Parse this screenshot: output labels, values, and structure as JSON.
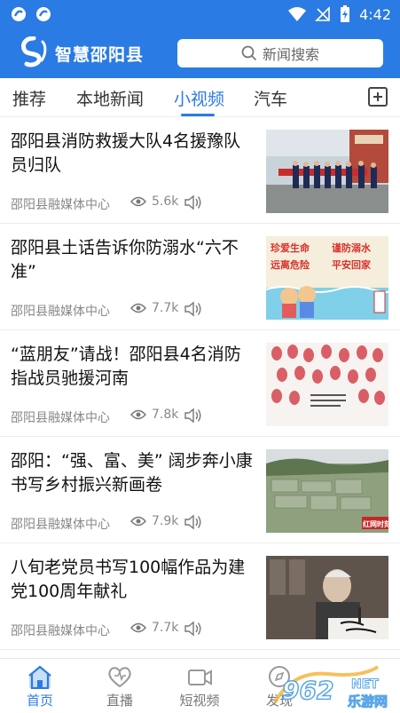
{
  "status_bar": {
    "time": "4:42"
  },
  "header": {
    "app_name": "智慧邵阳县",
    "search_placeholder": "新闻搜索"
  },
  "tabs": [
    {
      "label": "推荐",
      "active": false
    },
    {
      "label": "本地新闻",
      "active": false
    },
    {
      "label": "小视频",
      "active": true
    },
    {
      "label": "汽车",
      "active": false
    }
  ],
  "news": [
    {
      "title": "邵阳县消防救援大队4名援豫队员归队",
      "source": "邵阳县融媒体中心",
      "views": "5.6k",
      "thumb_icon": "firefighters-photo"
    },
    {
      "title": "邵阳县土话告诉你防溺水“六不准”",
      "source": "邵阳县融媒体中心",
      "views": "7.7k",
      "thumb_icon": "drowning-prevention-poster",
      "thumb_text": [
        "珍爱生命",
        "谨防溺水",
        "远离危险",
        "平安回家"
      ]
    },
    {
      "title": "“蓝朋友”请战！邵阳县4名消防指战员驰援河南",
      "source": "邵阳县融媒体中心",
      "views": "7.8k",
      "thumb_icon": "fingerprint-petition-photo"
    },
    {
      "title": "邵阳：“强、富、美” 阔步奔小康 书写乡村振兴新画卷",
      "source": "邵阳县融媒体中心",
      "views": "7.9k",
      "thumb_icon": "countryside-aerial-photo",
      "thumb_text": [
        "红网时刻"
      ]
    },
    {
      "title": "八旬老党员书写100幅作品为建党100周年献礼",
      "source": "邵阳县融媒体中心",
      "views": "7.7k",
      "thumb_icon": "calligraphy-elder-photo"
    }
  ],
  "bottom_nav": [
    {
      "label": "首页",
      "icon": "home-icon",
      "active": true
    },
    {
      "label": "直播",
      "icon": "heart-icon",
      "active": false
    },
    {
      "label": "短视频",
      "icon": "video-icon",
      "active": false
    },
    {
      "label": "发现",
      "icon": "discover-icon",
      "active": false
    }
  ],
  "watermark": {
    "brand": "962",
    "suffix": "乐游网",
    "domain": "NET"
  },
  "colors": {
    "brand_blue": "#2b7be4",
    "text_gray": "#888888"
  }
}
